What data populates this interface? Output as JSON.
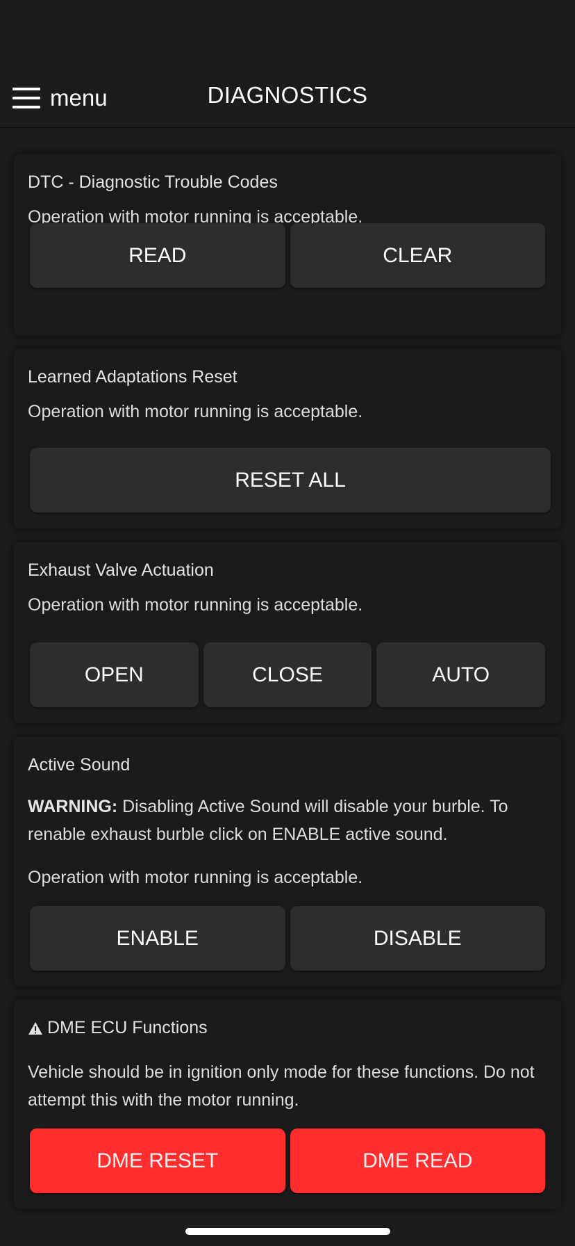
{
  "header": {
    "menu_label": "menu",
    "title": "DIAGNOSTICS"
  },
  "cards": [
    {
      "title": "DTC - Diagnostic Trouble Codes",
      "note": "Operation with motor running is acceptable.",
      "buttons": [
        "READ",
        "CLEAR"
      ]
    },
    {
      "title": "Learned Adaptations Reset",
      "note": "Operation with motor running is acceptable.",
      "buttons": [
        "RESET ALL"
      ]
    },
    {
      "title": "Exhaust Valve Actuation",
      "note": "Operation with motor running is acceptable.",
      "buttons": [
        "OPEN",
        "CLOSE",
        "AUTO"
      ]
    },
    {
      "title": "Active Sound",
      "warning_label": "WARNING:",
      "warning_text": " Disabling Active Sound will disable your burble. To renable exhaust burble click on ENABLE active sound.",
      "note": "Operation with motor running is acceptable.",
      "buttons": [
        "ENABLE",
        "DISABLE"
      ]
    },
    {
      "title": "DME ECU Functions",
      "title_icon": "warning-triangle-icon",
      "note": "Vehicle should be in ignition only mode for these functions. Do not attempt this with the motor running.",
      "buttons": [
        "DME RESET",
        "DME READ"
      ]
    }
  ],
  "colors": {
    "background": "#1c1c1c",
    "card": "#1b1b1b",
    "button": "#2d2d2d",
    "danger_button": "#ff2d2d",
    "text": "#e6e6e6"
  }
}
